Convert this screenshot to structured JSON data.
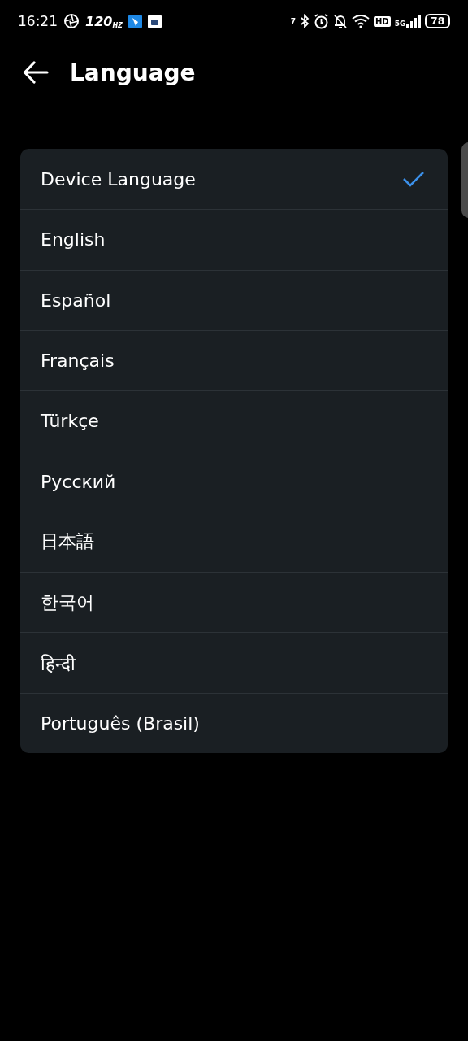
{
  "status_bar": {
    "time": "16:21",
    "refresh_rate": "120",
    "refresh_unit": "HZ",
    "data_speed": "7",
    "hd_label": "HD",
    "network": "5G",
    "battery": "78"
  },
  "header": {
    "title": "Language"
  },
  "languages": [
    {
      "label": "Device Language",
      "selected": true
    },
    {
      "label": "English",
      "selected": false
    },
    {
      "label": "Español",
      "selected": false
    },
    {
      "label": "Français",
      "selected": false
    },
    {
      "label": "Türkçe",
      "selected": false
    },
    {
      "label": "Русский",
      "selected": false
    },
    {
      "label": "日本語",
      "selected": false
    },
    {
      "label": "한국어",
      "selected": false
    },
    {
      "label": "हिन्दी",
      "selected": false
    },
    {
      "label": "Português (Brasil)",
      "selected": false
    }
  ]
}
